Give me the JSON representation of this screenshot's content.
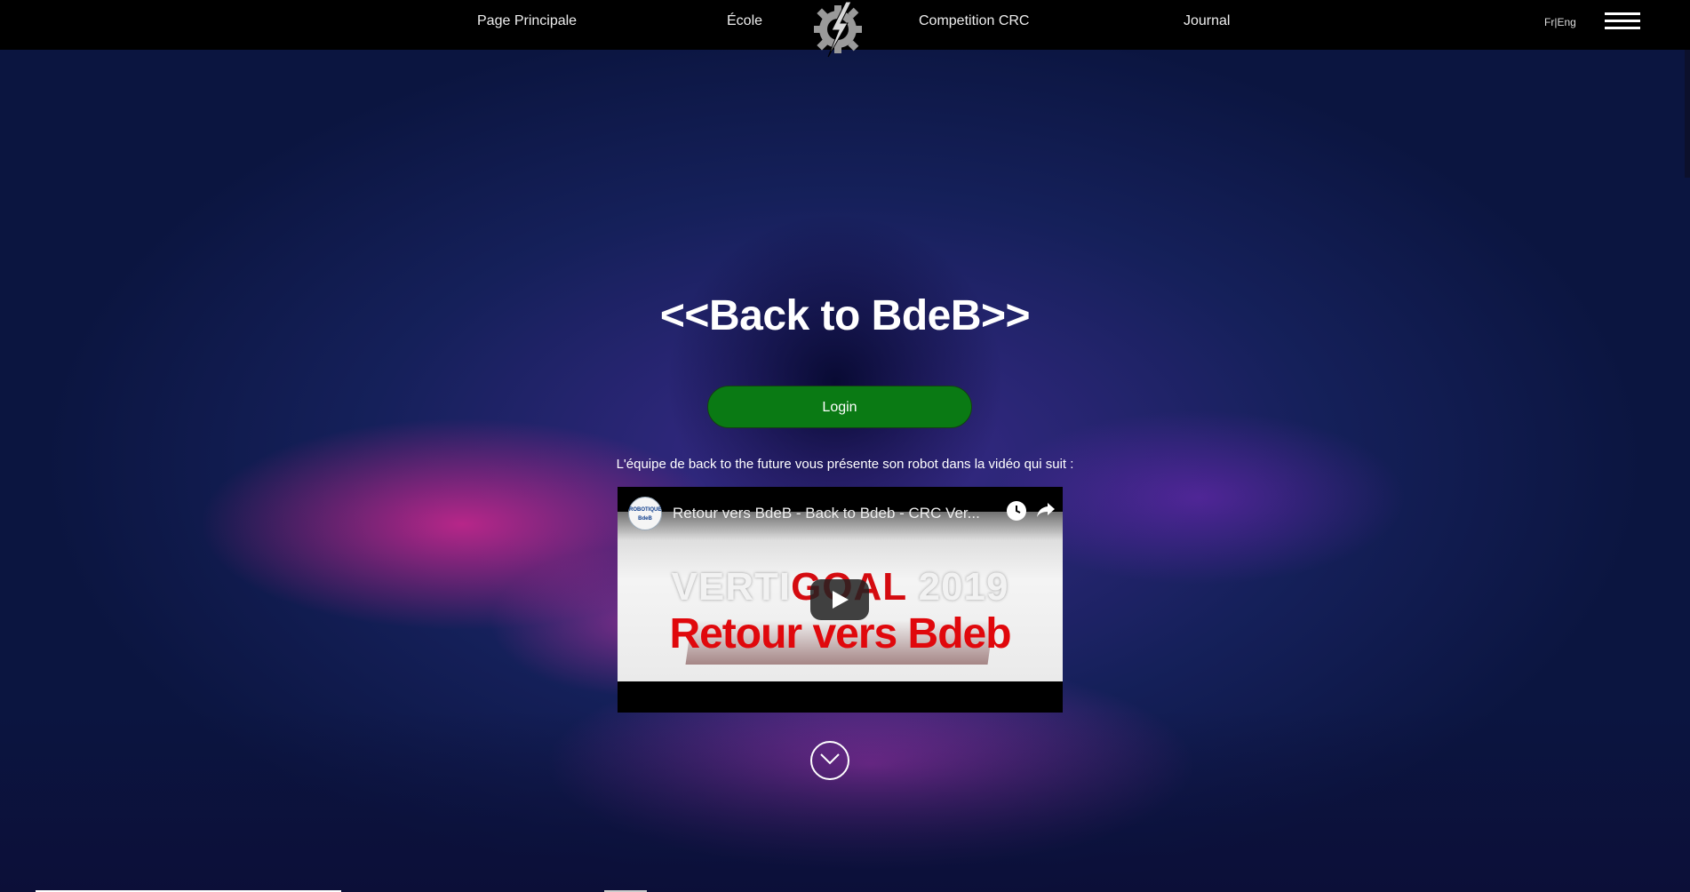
{
  "nav": {
    "links": [
      "Page Principale",
      "École",
      "Competition CRC",
      "Journal"
    ],
    "lang": "Fr|Eng"
  },
  "hero": {
    "title": "<<Back to BdeB>>",
    "login_label": "Login",
    "intro_text": "L'équipe de back to the future vous présente son robot dans la vidéo qui suit :"
  },
  "video": {
    "title": "Retour vers BdeB - Back to Bdeb - CRC Ver...",
    "channel": "ROBOTIQUE BdeB",
    "thumb_line1_a": "VERTI",
    "thumb_line1_b": "GOAL",
    "thumb_line1_c": " 2019",
    "thumb_line2": "Retour vers Bdeb"
  },
  "colors": {
    "login_green": "#0a7a14",
    "nav_bg": "#000000"
  }
}
